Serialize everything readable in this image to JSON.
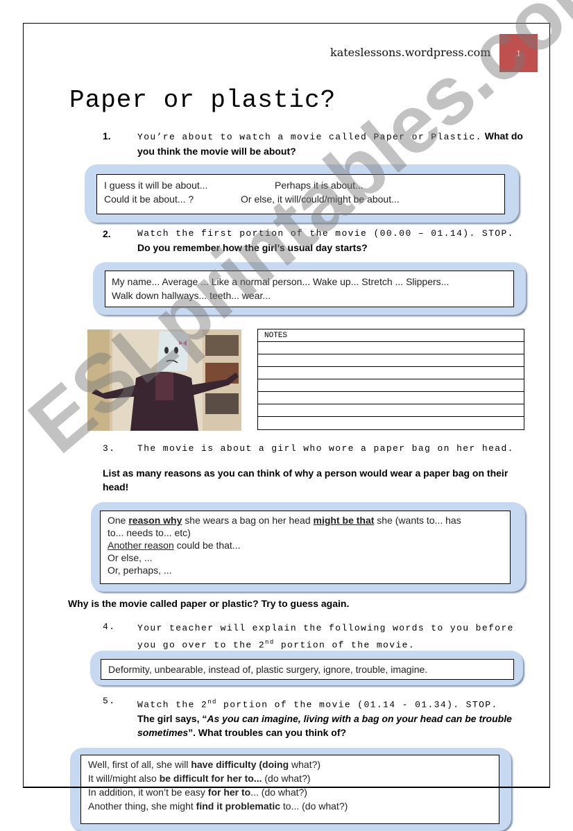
{
  "header": {
    "site": "kateslessons.wordpress.com",
    "page_number": "1",
    "page_number_color": "#c0504d"
  },
  "title": "Paper or plastic?",
  "q1": {
    "number": "1.",
    "text_mono": "You’re about to watch a movie called Paper or Plastic.",
    "text_bold": "What do you think the movie will be about?",
    "box": {
      "line1_a": "I guess it will be about...",
      "line1_b": "Perhaps it is about...",
      "line2_a": "Could it be about... ?",
      "line2_b": "Or else, it will/could/might be about..."
    }
  },
  "q2": {
    "number": "2.",
    "text_mono": "Watch the first portion of the movie (00.00 – 01.14). STOP.",
    "text_bold": "Do you remember how  the girl’s usual day starts?",
    "box": {
      "line1": "My name...  Average ... Like a normal person...  Wake up... Stretch ...  Slippers...",
      "line2": "Walk down hallways... teeth...  wear..."
    }
  },
  "image": {
    "description": "Girl wearing a paper bag with a sad face on her head, shrugging"
  },
  "notes": {
    "header": "NOTES",
    "blank_rows": 7
  },
  "q3": {
    "number": "3.",
    "text_mono": "The movie is about a girl who wore a paper bag on her head.",
    "text_bold": "List as many reasons as you can think of why a person would wear a paper bag on their head!",
    "box": {
      "l1_a": "One ",
      "l1_b": "reason why",
      "l1_c": " she wears a bag on her head ",
      "l1_d": "might be that",
      "l1_e": " she (wants to...  has",
      "l2": "to...  needs to...  etc)",
      "l3_a": "Another reason",
      "l3_b": " could be that...",
      "l4": "Or else, ...",
      "l5": "Or, perhaps, ..."
    }
  },
  "guess_again": "Why is the movie called paper or plastic? Try to guess again.",
  "q4": {
    "number": "4.",
    "text_line1": "Your teacher will explain the following words to you before",
    "text_line2_a": "you go over to the 2",
    "text_line2_sup": "nd",
    "text_line2_b": " portion of the movie.",
    "box": "Deformity, unbearable, instead of, plastic surgery, ignore, trouble, imagine."
  },
  "q5": {
    "number": "5.",
    "text_a": "Watch the 2",
    "text_sup": "nd",
    "text_b": " portion of the movie (01.14 -  01.34). STOP.",
    "bold_a": "The girl says, “",
    "bold_italic": "As you can imagine, living with a bag on your head can be trouble sometimes",
    "bold_b": "”.  What troubles can you think of?",
    "box": {
      "l1_a": "Well, first of all, she will ",
      "l1_b": "have difficulty (doing",
      "l1_c": " what?)",
      "l2_a": "It will/might also ",
      "l2_b": "be difficult for her to...",
      "l2_c": " (do what?)",
      "l3_a": "In addition, it won’t be easy ",
      "l3_b": "for her to",
      "l3_c": "...  (do what?)",
      "l4_a": "Another thing, she might ",
      "l4_b": "find it problematic",
      "l4_c": " to...  (do what?)"
    }
  },
  "watermark": "ESLprintables.com"
}
